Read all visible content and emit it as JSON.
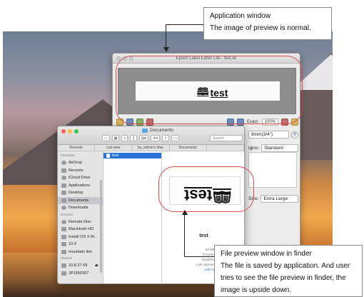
{
  "callouts": {
    "top": {
      "line1": "Application window",
      "line2": "The image of preview is normal."
    },
    "bottom": {
      "line1": "File preview window in finder",
      "line2": "The file is saved by application. And user",
      "line3": "tries to see the file preview in finder, the",
      "line4": "image is upside down."
    }
  },
  "app_window": {
    "title": "Epson Label Editor Lite - test.lel",
    "label_text": "test",
    "toolbar": {
      "zoom_label": "Exact:",
      "zoom_value": "100%"
    },
    "form": {
      "tape_value": "8mm(3/4\")",
      "margins_label": "igins:",
      "margins_value": "Standard",
      "size_label": "Size:",
      "size_value": "Extra Large",
      "help": "?"
    }
  },
  "finder": {
    "window_title": "Documents",
    "search_placeholder": "Search",
    "tabs": [
      "Recents",
      "List view",
      "by_admin's Mac",
      "Documents",
      ""
    ],
    "sidebar": {
      "favorites_header": "Favorites",
      "favorites": [
        "AirDrop",
        "Recents",
        "iCloud Drive",
        "Applications",
        "Desktop",
        "Documents",
        "Downloads"
      ],
      "devices_header": "Devices",
      "devices": [
        "Remote Disc",
        "Macintosh HD",
        "Install OS X M...",
        "10.9",
        "mountain lion"
      ],
      "shared_header": "Shared",
      "shared": [
        "10.8.27.69",
        "JP1550307"
      ]
    },
    "selected_file": "test",
    "preview": {
      "label_text": "test",
      "file_name": "test",
      "meta_labels": [
        "60 KB",
        "Created",
        "Modified",
        "Last opened"
      ],
      "meta_values": [
        "",
        "Octob",
        "Octob",
        ""
      ],
      "add_tags": "Add Ta"
    }
  },
  "colors": {
    "highlight": "#d84a4a",
    "selection": "#2a72d9"
  }
}
